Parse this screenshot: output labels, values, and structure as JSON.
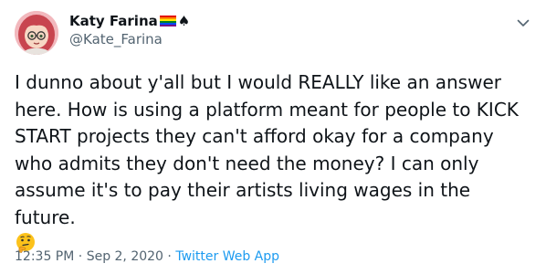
{
  "user": {
    "display_name": "Katy Farina",
    "handle": "@Kate_Farina",
    "name_emoji_flag": "rainbow-flag",
    "name_emoji_spade": "♠"
  },
  "tweet": {
    "text": "I dunno about y'all but I would REALLY like an answer here. How is using a platform meant for people to KICK START projects they can't afford okay for a company who admits they don't need the money? I can only assume it's to pay their artists living wages in the future.",
    "emoji": "thinking-face"
  },
  "meta": {
    "time": "12:35 PM",
    "separator1": " · ",
    "date": "Sep 2, 2020",
    "separator2": " · ",
    "source": "Twitter Web App"
  },
  "colors": {
    "text": "#0f1419",
    "secondary": "#536471",
    "link": "#1d9bf0"
  }
}
